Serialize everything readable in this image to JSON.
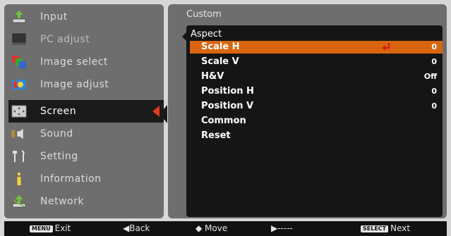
{
  "colors": {
    "panel_bg": "#6e6e6e",
    "inner_bg": "#151515",
    "highlight": "#d9660f",
    "active_arrow": "#e23a1e"
  },
  "left_menu": {
    "items": [
      {
        "label": "Input",
        "icon": "input-icon"
      },
      {
        "label": "PC adjust",
        "icon": "pc-adjust-icon"
      },
      {
        "label": "Image select",
        "icon": "image-select-icon"
      },
      {
        "label": "Image adjust",
        "icon": "image-adjust-icon"
      },
      {
        "label": "Screen",
        "icon": "screen-icon"
      },
      {
        "label": "Sound",
        "icon": "sound-icon"
      },
      {
        "label": "Setting",
        "icon": "setting-icon"
      },
      {
        "label": "Information",
        "icon": "information-icon"
      },
      {
        "label": "Network",
        "icon": "network-icon"
      }
    ]
  },
  "right_panel": {
    "title": "Custom",
    "section": "Aspect",
    "rows": [
      {
        "label": "Scale H",
        "value": "0"
      },
      {
        "label": "Scale V",
        "value": "0"
      },
      {
        "label": "H&V",
        "value": "Off"
      },
      {
        "label": "Position H",
        "value": "0"
      },
      {
        "label": "Position V",
        "value": "0"
      },
      {
        "label": "Common",
        "value": ""
      },
      {
        "label": "Reset",
        "value": ""
      }
    ]
  },
  "bottom_bar": {
    "menu_key": "MENU",
    "exit": "Exit",
    "back": "◀Back",
    "move": "◆ Move",
    "next_dash": "▶-----",
    "select_key": "SELECT",
    "next": "Next"
  }
}
